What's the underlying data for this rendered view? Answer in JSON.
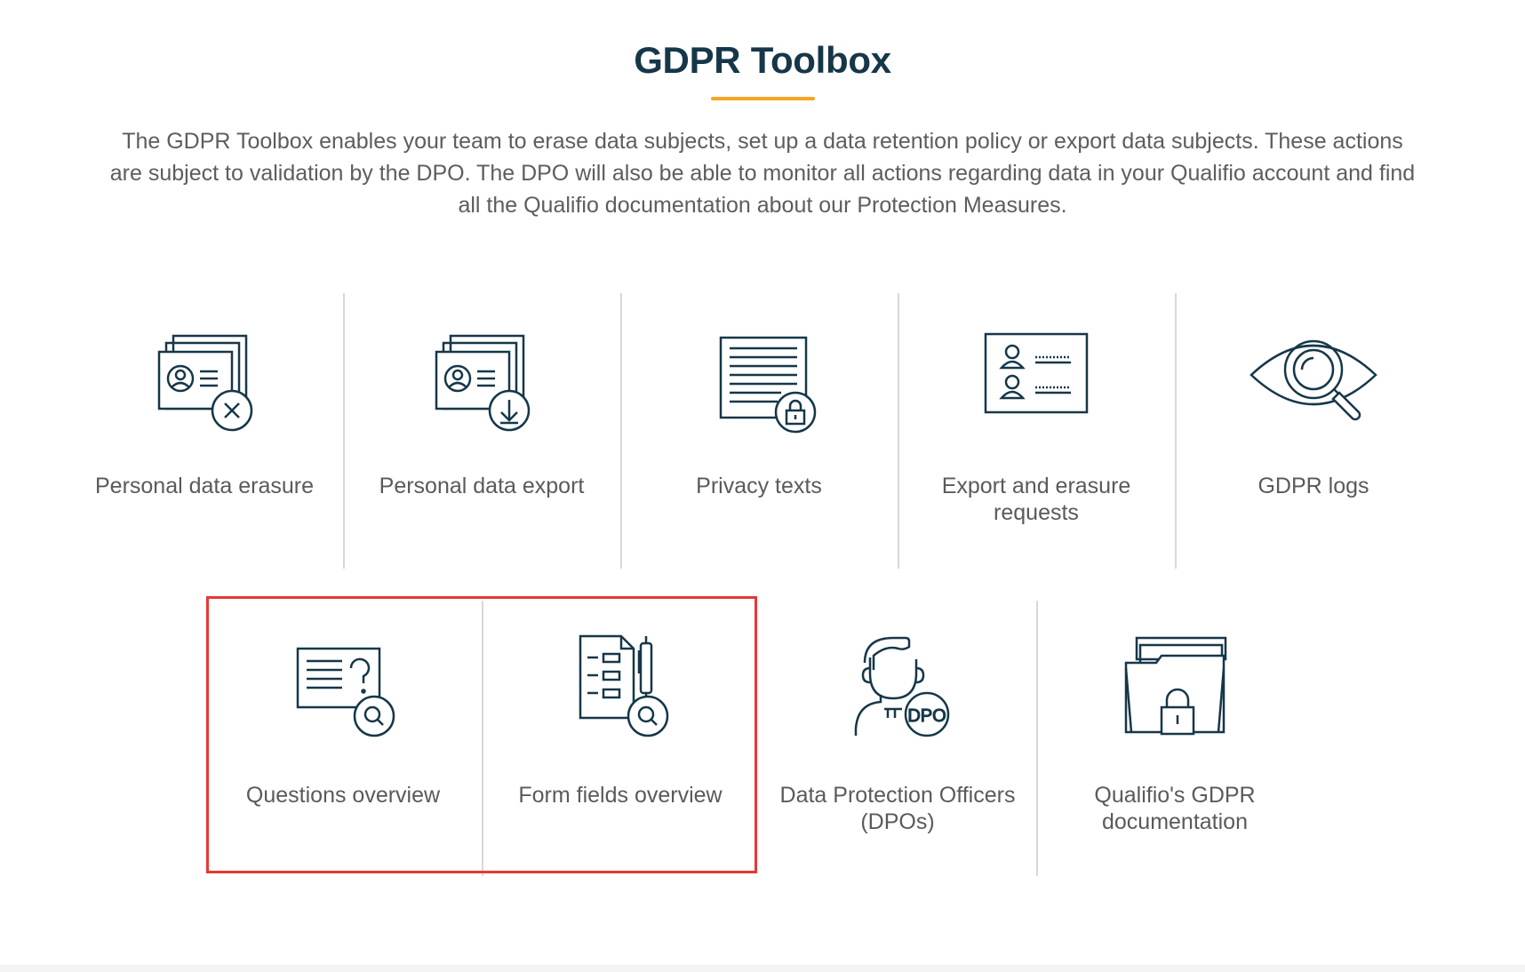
{
  "header": {
    "title": "GDPR Toolbox",
    "accent_color": "#f5a623",
    "title_color": "#163749"
  },
  "intro": {
    "text": "The GDPR Toolbox enables your team to erase data subjects, set up a data retention policy or export data subjects. These actions are subject to validation by the DPO. The DPO will also be able to monitor all actions regarding data in your Qualifio account and find all the Qualifio documentation about our Protection Measures."
  },
  "tiles_row1": [
    {
      "label": "Personal data erasure",
      "icon": "id-cards-erase-icon"
    },
    {
      "label": "Personal data export",
      "icon": "id-cards-download-icon"
    },
    {
      "label": "Privacy texts",
      "icon": "document-lock-icon"
    },
    {
      "label": "Export and erasure requests",
      "icon": "users-list-card-icon"
    },
    {
      "label": "GDPR logs",
      "icon": "eye-magnifier-icon"
    }
  ],
  "tiles_row2": [
    {
      "label": "Questions overview",
      "icon": "question-card-search-icon"
    },
    {
      "label": "Form fields overview",
      "icon": "form-pen-search-icon"
    },
    {
      "label": "Data Protection Officers (DPOs)",
      "icon": "dpo-person-icon"
    },
    {
      "label": "Qualifio's GDPR documentation",
      "icon": "folder-lock-icon"
    }
  ],
  "highlight": {
    "color": "#e53935"
  }
}
